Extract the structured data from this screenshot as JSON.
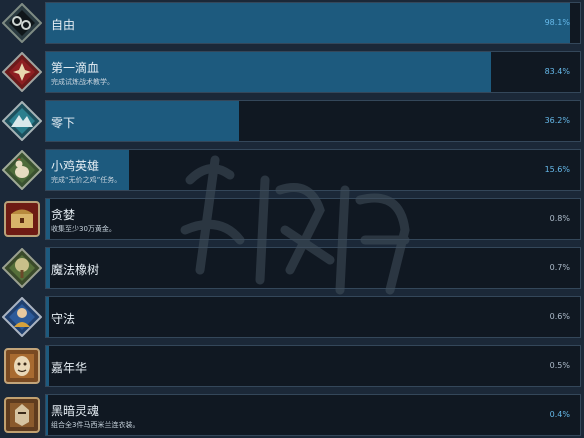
{
  "achievements": [
    {
      "name": "自由",
      "desc": "",
      "percent": "98.1%",
      "fill": 0.981
    },
    {
      "name": "第一滴血",
      "desc": "完成试炼战术教学。",
      "percent": "83.4%",
      "fill": 0.834
    },
    {
      "name": "零下",
      "desc": "",
      "percent": "36.2%",
      "fill": 0.362
    },
    {
      "name": "小鸡英雄",
      "desc": "完成“无价之鸡”任务。",
      "percent": "15.6%",
      "fill": 0.156
    },
    {
      "name": "贪婪",
      "desc": "收集至少30万黄金。",
      "percent": "0.8%",
      "fill": 0.008
    },
    {
      "name": "魔法橡树",
      "desc": "",
      "percent": "0.7%",
      "fill": 0.007
    },
    {
      "name": "守法",
      "desc": "",
      "percent": "0.6%",
      "fill": 0.006
    },
    {
      "name": "嘉年华",
      "desc": "",
      "percent": "0.5%",
      "fill": 0.005
    },
    {
      "name": "黑暗灵魂",
      "desc": "组合全3件马西米兰连衣装。",
      "percent": "0.4%",
      "fill": 0.004
    }
  ],
  "icons": [
    "chains-icon",
    "rose-crest-icon",
    "snow-mountain-icon",
    "chicken-icon",
    "treasure-icon",
    "oak-tree-icon",
    "guard-icon",
    "carnival-mask-icon",
    "dark-knight-icon"
  ],
  "colors": {
    "background": "#1b2838",
    "bar_fill": "#1d5a7e",
    "percent_highlight": "#66b9ea"
  }
}
